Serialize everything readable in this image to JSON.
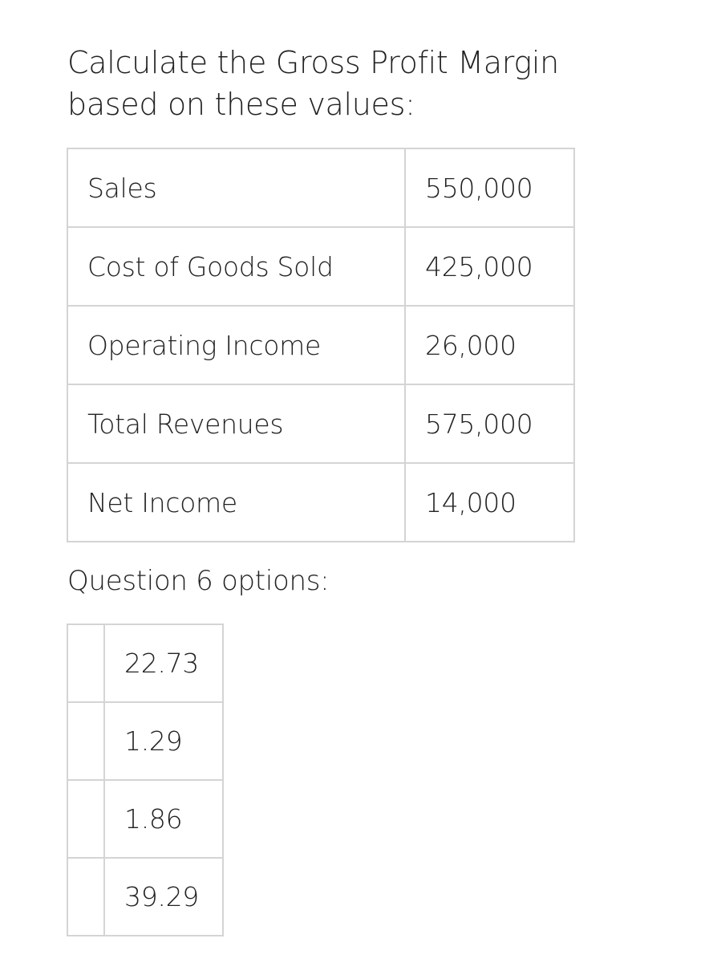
{
  "question": {
    "line1": "Calculate the Gross Profit Margin",
    "line2": "based on these values:"
  },
  "values_table": [
    {
      "label": "Sales",
      "value": "550,000"
    },
    {
      "label": "Cost of Goods Sold",
      "value": "425,000"
    },
    {
      "label": "Operating Income",
      "value": "26,000"
    },
    {
      "label": "Total Revenues",
      "value": "575,000"
    },
    {
      "label": "Net Income",
      "value": "14,000"
    }
  ],
  "options_label": "Question 6 options:",
  "options": [
    "22.73",
    "1.29",
    "1.86",
    "39.29"
  ]
}
